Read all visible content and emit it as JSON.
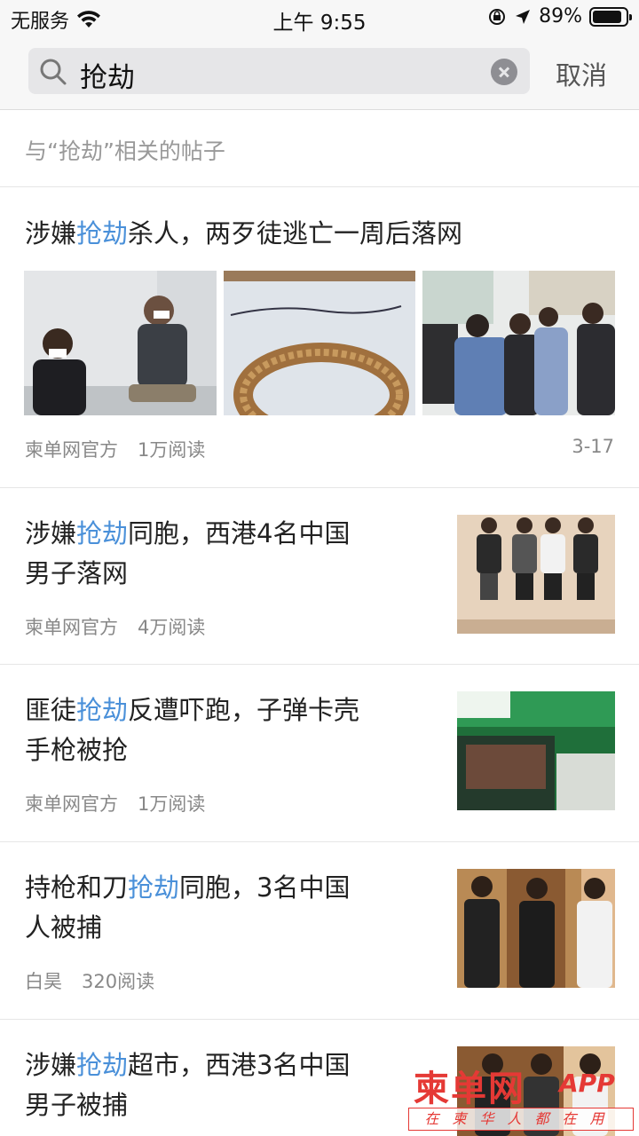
{
  "status_bar": {
    "carrier": "无服务",
    "time": "上午 9:55",
    "battery": "89%",
    "battery_level": 0.89
  },
  "search": {
    "query": "抢劫",
    "cancel_label": "取消"
  },
  "section_title": "与“抢劫”相关的帖子",
  "posts": [
    {
      "title_pre": "涉嫌",
      "title_hl": "抢劫",
      "title_post": "杀人，两歹徒逃亡一周后落网",
      "author": "柬单网官方",
      "reads": "1万阅读",
      "date": "3-17",
      "images": [
        "arrest-photo",
        "gold-bracelet-note-photo",
        "police-crowd-photo"
      ]
    },
    {
      "title_pre": "涉嫌",
      "title_hl": "抢劫",
      "title_post": "同胞，西港4名中国",
      "title_line2": "男子落网",
      "author": "柬单网官方",
      "reads": "4万阅读",
      "images": [
        "four-suspects-photo"
      ]
    },
    {
      "title_pre": "匪徒",
      "title_hl": "抢劫",
      "title_post": "反遭吓跑，子弹卡壳",
      "title_line2": "手枪被抢",
      "author": "柬单网官方",
      "reads": "1万阅读",
      "images": [
        "storefront-photo"
      ]
    },
    {
      "title_pre": "持枪和刀",
      "title_hl": "抢劫",
      "title_post": "同胞，3名中国",
      "title_line2": "人被捕",
      "author": "白昊",
      "reads": "320阅读",
      "images": [
        "three-suspects-photo"
      ]
    },
    {
      "title_pre": "涉嫌",
      "title_hl": "抢劫",
      "title_post": "超市，西港3名中国",
      "title_line2": "男子被捕",
      "images": [
        "supermarket-suspects-photo"
      ]
    }
  ],
  "watermark": {
    "logo": "柬单网",
    "app": "APP",
    "tagline": "在柬华人都在用"
  },
  "colors": {
    "highlight": "#4a90d9",
    "watermark": "#e53935"
  }
}
